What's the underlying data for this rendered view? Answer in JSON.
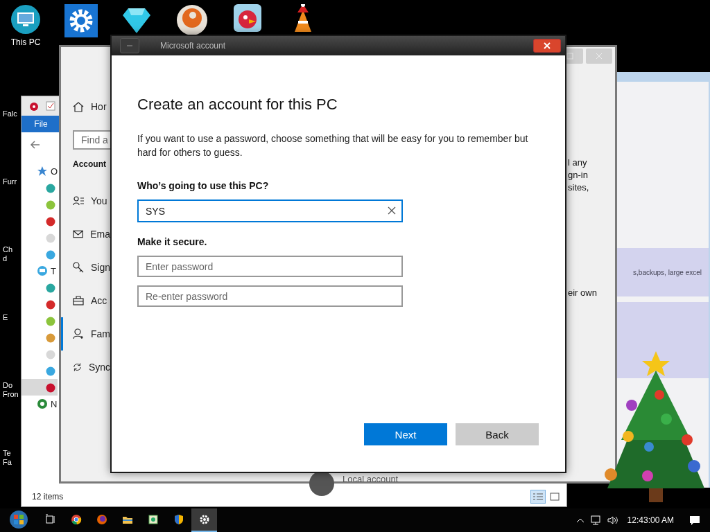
{
  "desktop": {
    "top_icons": [
      {
        "kind": "monitor",
        "label": "This PC"
      },
      {
        "kind": "gear"
      },
      {
        "kind": "diamond"
      },
      {
        "kind": "letter-ball"
      },
      {
        "kind": "bird"
      },
      {
        "kind": "cone"
      }
    ],
    "side_labels": [
      {
        "lines": [
          "Falc"
        ]
      },
      {
        "lines": [
          "Furr"
        ]
      },
      {
        "lines": [
          "Ch",
          "d"
        ]
      },
      {
        "lines": [
          "E"
        ]
      },
      {
        "lines": [
          "Do",
          "Fron"
        ]
      },
      {
        "lines": [
          "Te",
          "Fa"
        ]
      }
    ]
  },
  "browser_window": {
    "snippet": "s,backups, large excel"
  },
  "explorer_window": {
    "ribbon_tab": "File",
    "tree": [
      {
        "label": "O",
        "kind": "star",
        "children": [
          {
            "color": "#2aa7a0",
            "selected": false
          },
          {
            "color": "#8cc43c",
            "selected": false
          },
          {
            "color": "#d42a2a",
            "selected": false
          },
          {
            "color": "#d8d8d8",
            "selected": false
          },
          {
            "color": "#3aa8e0",
            "selected": false
          }
        ]
      },
      {
        "label": "T",
        "kind": "globe",
        "children": [
          {
            "color": "#2aa7a0",
            "selected": false
          },
          {
            "color": "#d42a2a",
            "selected": false
          },
          {
            "color": "#8cc43c",
            "selected": false
          },
          {
            "color": "#d89a3a",
            "selected": false
          },
          {
            "color": "#d8d8d8",
            "selected": false
          },
          {
            "color": "#3aa8e0",
            "selected": false
          },
          {
            "color": "#c8102e",
            "selected": true
          }
        ]
      },
      {
        "label": "N",
        "kind": "globe-green"
      }
    ],
    "status": "12 items"
  },
  "settings_window": {
    "home": "Hor",
    "search_placeholder": "Find a",
    "heading": "Account",
    "items": [
      {
        "kind": "person-list",
        "label": "You",
        "selected": false
      },
      {
        "kind": "mail",
        "label": "Ema",
        "selected": false
      },
      {
        "kind": "key",
        "label": "Sign",
        "selected": false
      },
      {
        "kind": "briefcase",
        "label": "Acc",
        "selected": false
      },
      {
        "kind": "person-add",
        "label": "Fam",
        "selected": true
      },
      {
        "kind": "sync",
        "label": "Sync",
        "selected": false
      }
    ],
    "right_lines": [
      "l any",
      "gn-in",
      "sites,",
      "eir own"
    ],
    "bottom_item": "Local account"
  },
  "dialog": {
    "title": "Microsoft account",
    "heading": "Create an account for this PC",
    "intro": "If you want to use a password, choose something that will be easy for you to remember but hard for others to guess.",
    "user_label": "Who’s going to use this PC?",
    "user_value": "SYS",
    "secure_label": "Make it secure.",
    "password_placeholder": "Enter password",
    "reenter_placeholder": "Re-enter password",
    "buttons": [
      {
        "label": "Next",
        "kind": "primary"
      },
      {
        "label": "Back",
        "kind": "secondary"
      }
    ]
  },
  "taskbar": {
    "apps": [
      {
        "kind": "task-view",
        "active": false
      },
      {
        "kind": "chrome",
        "active": false
      },
      {
        "kind": "firefox",
        "active": false
      },
      {
        "kind": "folder",
        "active": false
      },
      {
        "kind": "app",
        "active": false
      },
      {
        "kind": "shield",
        "active": false
      },
      {
        "kind": "gear",
        "active": true
      }
    ],
    "clock": "12:43:00 AM"
  }
}
